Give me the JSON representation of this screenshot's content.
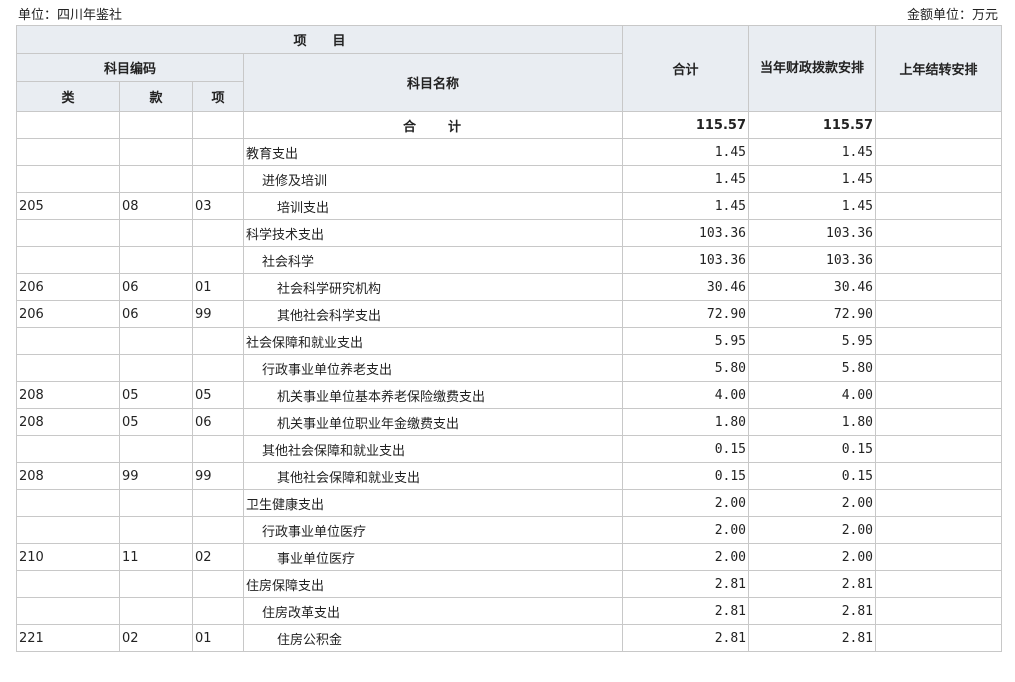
{
  "header": {
    "unit_label": "单位：四川年鉴社",
    "amount_unit_label": "金额单位：万元"
  },
  "columns": {
    "item": "项　　目",
    "code_group": "科目编码",
    "lei": "类",
    "kuan": "款",
    "xiang": "项",
    "name": "科目名称",
    "total": "合计",
    "current_year": "当年财政拨款安排",
    "prior_year": "上年结转安排"
  },
  "rows": [
    {
      "lei": "",
      "kuan": "",
      "xiang": "",
      "name": "合　　计",
      "level": "total",
      "total": "115.57",
      "current": "115.57",
      "prior": ""
    },
    {
      "lei": "",
      "kuan": "",
      "xiang": "",
      "name": "教育支出",
      "level": "0",
      "total": "1.45",
      "current": "1.45",
      "prior": ""
    },
    {
      "lei": "",
      "kuan": "",
      "xiang": "",
      "name": "进修及培训",
      "level": "1",
      "total": "1.45",
      "current": "1.45",
      "prior": ""
    },
    {
      "lei": "205",
      "kuan": "08",
      "xiang": "03",
      "name": "培训支出",
      "level": "2",
      "total": "1.45",
      "current": "1.45",
      "prior": ""
    },
    {
      "lei": "",
      "kuan": "",
      "xiang": "",
      "name": "科学技术支出",
      "level": "0",
      "total": "103.36",
      "current": "103.36",
      "prior": ""
    },
    {
      "lei": "",
      "kuan": "",
      "xiang": "",
      "name": "社会科学",
      "level": "1",
      "total": "103.36",
      "current": "103.36",
      "prior": ""
    },
    {
      "lei": "206",
      "kuan": "06",
      "xiang": "01",
      "name": "社会科学研究机构",
      "level": "2",
      "total": "30.46",
      "current": "30.46",
      "prior": ""
    },
    {
      "lei": "206",
      "kuan": "06",
      "xiang": "99",
      "name": "其他社会科学支出",
      "level": "2",
      "total": "72.90",
      "current": "72.90",
      "prior": ""
    },
    {
      "lei": "",
      "kuan": "",
      "xiang": "",
      "name": "社会保障和就业支出",
      "level": "0",
      "total": "5.95",
      "current": "5.95",
      "prior": ""
    },
    {
      "lei": "",
      "kuan": "",
      "xiang": "",
      "name": "行政事业单位养老支出",
      "level": "1",
      "total": "5.80",
      "current": "5.80",
      "prior": ""
    },
    {
      "lei": "208",
      "kuan": "05",
      "xiang": "05",
      "name": "机关事业单位基本养老保险缴费支出",
      "level": "2",
      "total": "4.00",
      "current": "4.00",
      "prior": ""
    },
    {
      "lei": "208",
      "kuan": "05",
      "xiang": "06",
      "name": "机关事业单位职业年金缴费支出",
      "level": "2",
      "total": "1.80",
      "current": "1.80",
      "prior": ""
    },
    {
      "lei": "",
      "kuan": "",
      "xiang": "",
      "name": "其他社会保障和就业支出",
      "level": "1",
      "total": "0.15",
      "current": "0.15",
      "prior": ""
    },
    {
      "lei": "208",
      "kuan": "99",
      "xiang": "99",
      "name": "其他社会保障和就业支出",
      "level": "2",
      "total": "0.15",
      "current": "0.15",
      "prior": ""
    },
    {
      "lei": "",
      "kuan": "",
      "xiang": "",
      "name": "卫生健康支出",
      "level": "0",
      "total": "2.00",
      "current": "2.00",
      "prior": ""
    },
    {
      "lei": "",
      "kuan": "",
      "xiang": "",
      "name": "行政事业单位医疗",
      "level": "1",
      "total": "2.00",
      "current": "2.00",
      "prior": ""
    },
    {
      "lei": "210",
      "kuan": "11",
      "xiang": "02",
      "name": "事业单位医疗",
      "level": "2",
      "total": "2.00",
      "current": "2.00",
      "prior": ""
    },
    {
      "lei": "",
      "kuan": "",
      "xiang": "",
      "name": "住房保障支出",
      "level": "0",
      "total": "2.81",
      "current": "2.81",
      "prior": ""
    },
    {
      "lei": "",
      "kuan": "",
      "xiang": "",
      "name": "住房改革支出",
      "level": "1",
      "total": "2.81",
      "current": "2.81",
      "prior": ""
    },
    {
      "lei": "221",
      "kuan": "02",
      "xiang": "01",
      "name": "住房公积金",
      "level": "2",
      "total": "2.81",
      "current": "2.81",
      "prior": ""
    }
  ]
}
